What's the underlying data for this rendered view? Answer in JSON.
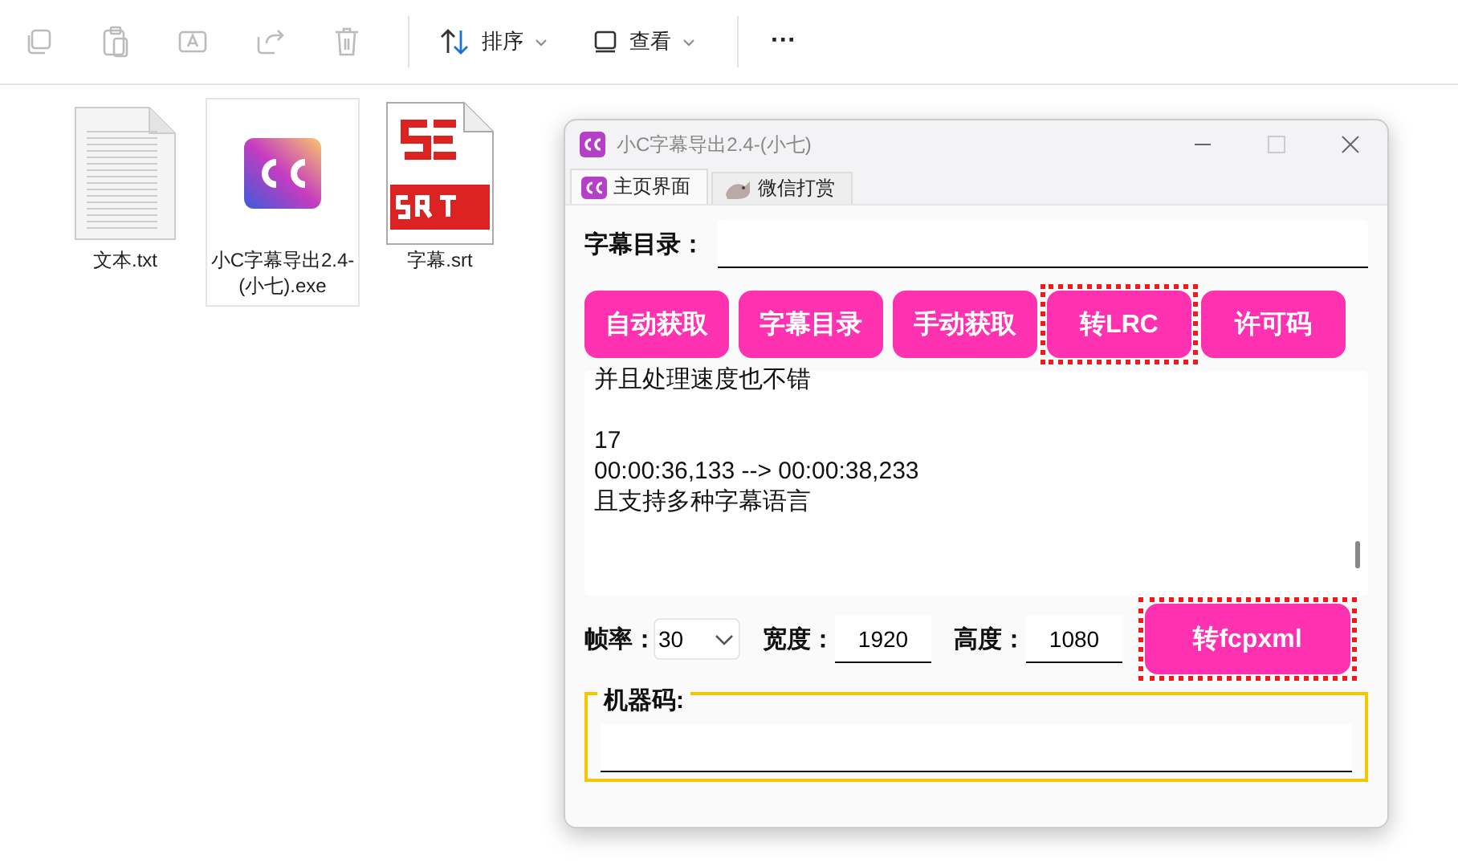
{
  "explorer": {
    "toolbar": {
      "icon_buttons": [
        {
          "disabled": true
        },
        {
          "disabled": true
        },
        {
          "disabled": true
        },
        {
          "disabled": true
        },
        {
          "disabled": true
        }
      ],
      "sort": {
        "label": "排序"
      },
      "view": {
        "label": "查看"
      },
      "more": {
        "label": "···"
      }
    },
    "files": [
      {
        "kind": "txt",
        "name": "文本.txt",
        "selected": false
      },
      {
        "kind": "exe",
        "name": "小C字幕导出2.4-(小七).exe",
        "selected": true
      },
      {
        "kind": "srt",
        "name": "字幕.srt",
        "selected": false
      }
    ]
  },
  "app": {
    "window": {
      "title": "小C字幕导出2.4-(小七)"
    },
    "tabs": [
      {
        "label": "主页界面",
        "selected": true
      },
      {
        "label": "微信打赏",
        "selected": false
      }
    ],
    "dir_field": {
      "label": "字幕目录："
    },
    "buttons": [
      {
        "label": "自动获取",
        "highlighted": false
      },
      {
        "label": "字幕目录",
        "highlighted": false
      },
      {
        "label": "手动获取",
        "highlighted": false
      },
      {
        "label": "转LRC",
        "highlighted": true
      },
      {
        "label": "许可码",
        "highlighted": false
      }
    ],
    "log": {
      "text": "并且处理速度也不错\n\n17\n00:00:36,133 --> 00:00:38,233\n且支持多种字幕语言"
    },
    "frame_rate": {
      "label": "帧率：",
      "value": "30"
    },
    "width": {
      "label": "宽度：",
      "value": "1920"
    },
    "height": {
      "label": "高度：",
      "value": "1080"
    },
    "fcpxml_button": {
      "label": "转fcpxml",
      "highlighted": true
    },
    "machine_code": {
      "label": "机器码:"
    }
  }
}
